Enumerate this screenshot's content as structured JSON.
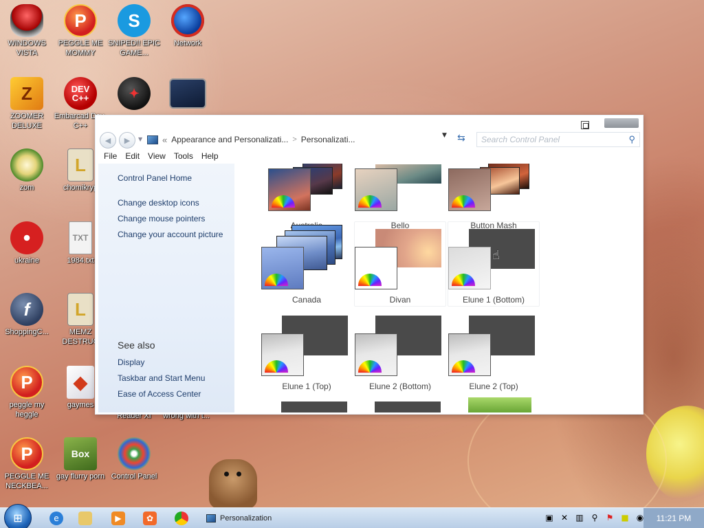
{
  "desktop": {
    "icons": [
      {
        "label": "WINDOWS VISTA"
      },
      {
        "label": "PEGGLE ME MOMMY"
      },
      {
        "label": "SNIPED!! EPIC GAME..."
      },
      {
        "label": "Network"
      },
      {
        "label": "ZOOMER DELUXE"
      },
      {
        "label": "Embarcad Dev-C++"
      },
      {
        "label": "zom"
      },
      {
        "label": "chomikryp"
      },
      {
        "label": "ukraine"
      },
      {
        "label": "1984.txt"
      },
      {
        "label": "ShoppingC..."
      },
      {
        "label": "MEMZ DESTRUC"
      },
      {
        "label": "peggle my heggle"
      },
      {
        "label": "gaymes"
      },
      {
        "label": "Reader XI"
      },
      {
        "label": "wrong with t..."
      },
      {
        "label": "PEGGLE ME NECKBEA..."
      },
      {
        "label": "gay flurry porn"
      },
      {
        "label": "Control Panel"
      }
    ],
    "icon_glyphs": {
      "peggle": "P",
      "skype": "S",
      "zoomer": "Z",
      "dev": "DEV C++",
      "lfile": "L",
      "txt": "TXT",
      "flash": "f",
      "box": "Box"
    }
  },
  "window": {
    "address": {
      "prefix": "«",
      "crumb1": "Appearance and Personalizati...",
      "separator": ">",
      "crumb2": "Personalizati..."
    },
    "search": {
      "placeholder": "Search Control Panel"
    },
    "menu": [
      "File",
      "Edit",
      "View",
      "Tools",
      "Help"
    ],
    "sidebar": {
      "home": "Control Panel Home",
      "links": [
        "Change desktop icons",
        "Change mouse pointers",
        "Change your account picture"
      ],
      "see_also_title": "See also",
      "see_also": [
        "Display",
        "Taskbar and Start Menu",
        "Ease of Access Center"
      ]
    },
    "themes": [
      {
        "name": "Australia"
      },
      {
        "name": "Bello"
      },
      {
        "name": "Button Mash"
      },
      {
        "name": "Canada"
      },
      {
        "name": "Divan"
      },
      {
        "name": "Elune 1 (Bottom)"
      },
      {
        "name": "Elune 1 (Top)"
      },
      {
        "name": "Elune 2 (Bottom)"
      },
      {
        "name": "Elune 2 (Top)"
      }
    ]
  },
  "taskbar": {
    "window_label": "Personalization",
    "clock": "11:21 PM"
  },
  "colors": {
    "link": "#1e3d6b",
    "clock_bg": "#8fa9c8"
  }
}
